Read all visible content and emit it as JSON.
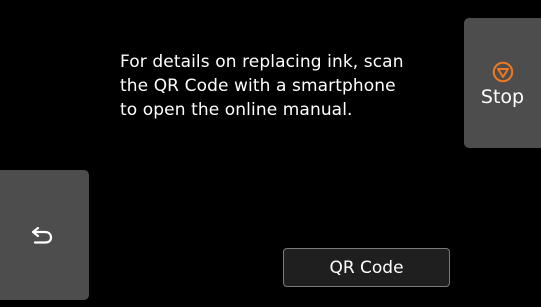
{
  "message": {
    "text": "For details on replacing ink, scan\nthe QR Code with a smartphone\nto open the online manual."
  },
  "stop_button": {
    "label": "Stop",
    "icon": "stop-icon",
    "icon_color": "#f07820"
  },
  "back_button": {
    "icon": "back-arrow-icon"
  },
  "qr_button": {
    "label": "QR Code"
  }
}
